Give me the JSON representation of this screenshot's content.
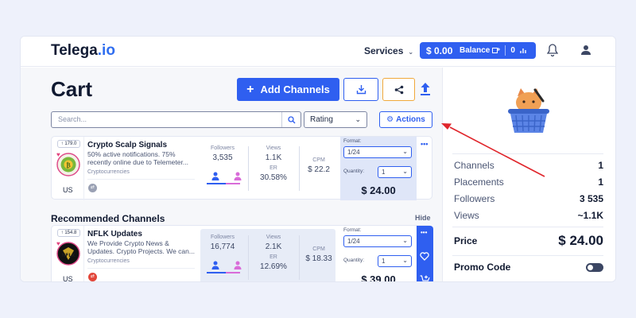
{
  "header": {
    "logo_text": "Telega",
    "logo_dot": ".io",
    "services_label": "Services",
    "balance_amount": "$ 0.00",
    "balance_label": "Balance",
    "balance_count": "0"
  },
  "cart": {
    "title": "Cart",
    "add_channels_label": "Add Channels",
    "search_placeholder": "Search...",
    "sort_selected": "Rating",
    "actions_label": "Actions"
  },
  "items": [
    {
      "rating": "179.0",
      "name": "Crypto Scalp Signals",
      "description": "50% active notifications. 75% recently online due to Telemeter...",
      "category": "Cryptocurrencies",
      "country": "US",
      "followers_label": "Followers",
      "followers": "3,535",
      "views_label": "Views",
      "views": "1.1K",
      "er_label": "ER",
      "er": "30.58%",
      "cpm_label": "CPM",
      "cpm": "$ 22.2",
      "format_label": "Format:",
      "format_value": "1/24",
      "quantity_label": "Quantity:",
      "quantity_value": "1",
      "price": "$ 24.00"
    }
  ],
  "recommended": {
    "title": "Recommended Channels",
    "hide_label": "Hide",
    "items": [
      {
        "rating": "154.8",
        "name": "NFLK Updates",
        "description": "We Provide Crypto News & Updates. Crypto Projects. We can...",
        "category": "Cryptocurrencies",
        "country": "US",
        "followers_label": "Followers",
        "followers": "16,774",
        "views_label": "Views",
        "views": "2.1K",
        "er_label": "ER",
        "er": "12.69%",
        "cpm_label": "CPM",
        "cpm": "$ 18.33",
        "format_label": "Format:",
        "format_value": "1/24",
        "quantity_label": "Quantity:",
        "quantity_value": "1",
        "price": "$ 39.00"
      }
    ]
  },
  "summary": {
    "channels_label": "Channels",
    "channels": "1",
    "placements_label": "Placements",
    "placements": "1",
    "followers_label": "Followers",
    "followers": "3 535",
    "views_label": "Views",
    "views": "~1.1K",
    "price_label": "Price",
    "price": "$ 24.00",
    "promo_label": "Promo Code"
  },
  "colors": {
    "accent": "#2f5ff0",
    "share_border": "#f0a93b",
    "arrow": "#e0252b",
    "page_bg": "#eef1fb"
  }
}
